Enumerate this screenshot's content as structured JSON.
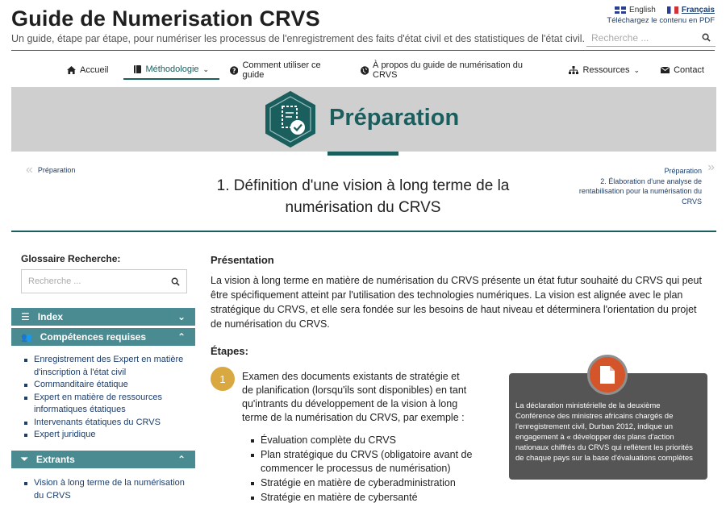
{
  "header": {
    "title": "Guide de Numerisation CRVS",
    "subtitle": "Un guide, étape par étape, pour numériser les processus de l'enregistrement des faits d'état civil et des statistiques de l'état civil.",
    "lang_en": "English",
    "lang_fr": "Français",
    "pdf_link": "Téléchargez le contenu en PDF",
    "search_placeholder": "Recherche ..."
  },
  "nav": [
    {
      "label": "Accueil",
      "icon": "home-icon"
    },
    {
      "label": "Méthodologie",
      "icon": "book-icon"
    },
    {
      "label": "Comment utiliser ce guide",
      "icon": "question-icon"
    },
    {
      "label": "À propos du guide de numérisation du CRVS",
      "icon": "globe-icon"
    },
    {
      "label": "Ressources",
      "icon": "sitemap-icon"
    },
    {
      "label": "Contact",
      "icon": "envelope-icon"
    }
  ],
  "banner": {
    "title": "Préparation"
  },
  "pager": {
    "prev_label": "Préparation",
    "next_section": "Préparation",
    "next_label": "2. Élaboration d'une analyse de rentabilisation pour la numérisation du CRVS"
  },
  "page_heading": "1. Définition d'une vision à long terme de la numérisation du CRVS",
  "sidebar": {
    "glossary_label": "Glossaire Recherche:",
    "search_placeholder": "Recherche ...",
    "index_label": "Index",
    "skills_label": "Compétences requises",
    "skills": [
      "Enregistrement des Expert en matière d'inscription à l'état civil",
      "Commanditaire étatique",
      "Expert en matière de ressources informatiques étatiques",
      "Intervenants étatiques du CRVS",
      "Expert juridique"
    ],
    "outputs_label": "Extrants",
    "outputs": [
      "Vision à long terme de la numérisation du CRVS"
    ]
  },
  "main": {
    "presentation_title": "Présentation",
    "presentation_text": "La vision à long terme en matière de numérisation du CRVS présente un état futur souhaité du CRVS qui peut être spécifiquement atteint par l'utilisation des technologies numériques. La vision est alignée avec le plan stratégique du CRVS, et elle sera fondée sur les besoins de haut niveau et déterminera l'orientation du projet de numérisation du CRVS.",
    "steps_title": "Étapes:",
    "step1_number": "1",
    "step1_text": "Examen des documents existants de stratégie et de planification (lorsqu'ils sont disponibles) en tant qu'intrants du développement de la vision à long terme de la numérisation du CRVS, par exemple :",
    "step1_bullets": [
      "Évaluation complète du CRVS",
      "Plan stratégique du CRVS (obligatoire avant de commencer le processus de numérisation)",
      "Stratégie en matière de cyberadministration",
      "Stratégie en matière de cybersanté"
    ],
    "callout_text": "La déclaration ministérielle de la deuxième Conférence des ministres africains chargés de l'enregistrement civil, Durban 2012, indique un engagement à « développer des plans d'action nationaux chiffrés du CRVS qui reflètent les priorités de chaque pays sur la base d'évaluations complètes"
  },
  "colors": {
    "accent_teal": "#1a5e5e",
    "sidebar_teal": "#4a8b92",
    "step_gold": "#d9a840",
    "callout_orange": "#d4552a"
  }
}
